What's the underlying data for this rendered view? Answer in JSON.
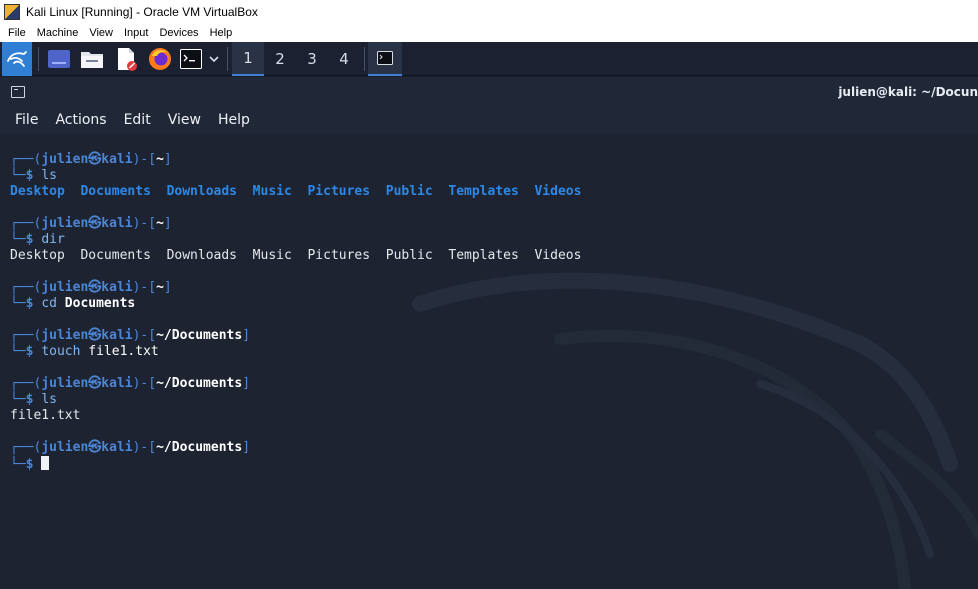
{
  "window": {
    "title": "Kali Linux [Running] - Oracle VM VirtualBox",
    "menu": [
      "File",
      "Machine",
      "View",
      "Input",
      "Devices",
      "Help"
    ]
  },
  "panel": {
    "workspaces": [
      "1",
      "2",
      "3",
      "4"
    ],
    "active_workspace": "1",
    "icons": [
      "kali-dragon-icon",
      "show-desktop-icon",
      "file-manager-icon",
      "text-editor-icon",
      "firefox-icon",
      "terminal-icon",
      "chevron-down-icon",
      "terminal-task-icon"
    ]
  },
  "terminal": {
    "title": "julien@kali: ~/Docun",
    "menu": [
      "File",
      "Actions",
      "Edit",
      "View",
      "Help"
    ],
    "user": "julien",
    "host": "kali",
    "blocks": [
      {
        "cwd": "~",
        "command": "ls",
        "args": "",
        "output": [
          "Desktop",
          "Documents",
          "Downloads",
          "Music",
          "Pictures",
          "Public",
          "Templates",
          "Videos"
        ],
        "output_style": "blue"
      },
      {
        "cwd": "~",
        "command": "dir",
        "args": "",
        "output": [
          "Desktop",
          "Documents",
          "Downloads",
          "Music",
          "Pictures",
          "Public",
          "Templates",
          "Videos"
        ],
        "output_style": "plain"
      },
      {
        "cwd": "~",
        "command": "cd",
        "args": "Documents",
        "output": []
      },
      {
        "cwd": "~/Documents",
        "command": "touch",
        "args": "file1.txt",
        "output": []
      },
      {
        "cwd": "~/Documents",
        "command": "ls",
        "args": "",
        "output": [
          "file1.txt"
        ],
        "output_style": "plain"
      },
      {
        "cwd": "~/Documents",
        "command": "",
        "args": "",
        "output": [],
        "cursor": true
      }
    ]
  },
  "colors": {
    "panel_bg": "#1b2131",
    "terminal_bg": "#1d2331",
    "prompt_blue": "#4b86d8",
    "dir_blue": "#2e88e6"
  }
}
